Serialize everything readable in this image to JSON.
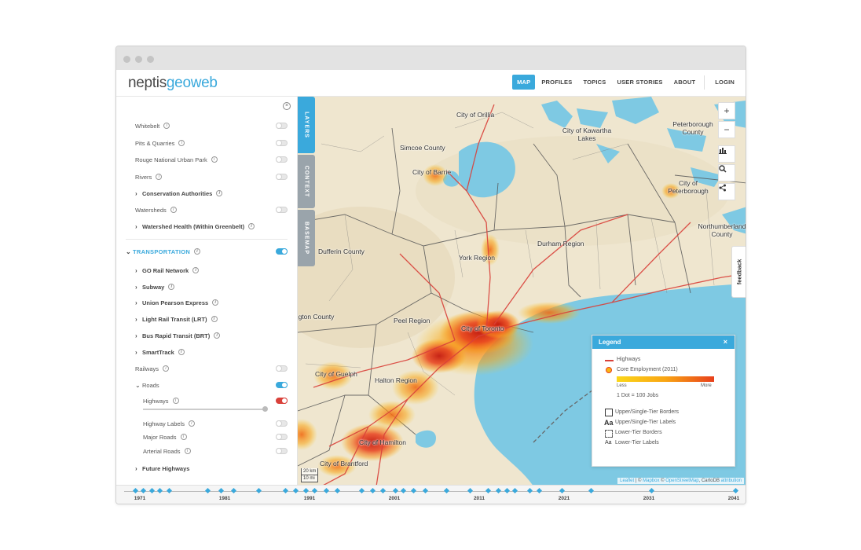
{
  "brand": {
    "part1": "neptis",
    "part2": "geoweb"
  },
  "nav": {
    "items": [
      "MAP",
      "PROFILES",
      "TOPICS",
      "USER STORIES",
      "ABOUT"
    ],
    "login": "LOGIN"
  },
  "side_tabs": [
    "LAYERS",
    "CONTEXT",
    "BASEMAP"
  ],
  "layers": {
    "items": [
      {
        "label": "Whitebelt",
        "type": "toggle",
        "state": "off"
      },
      {
        "label": "Pits & Quarries",
        "type": "toggle",
        "state": "off"
      },
      {
        "label": "Rouge National Urban Park",
        "type": "toggle",
        "state": "off"
      },
      {
        "label": "Rivers",
        "type": "toggle",
        "state": "off"
      },
      {
        "label": "Conservation Authorities",
        "type": "group"
      },
      {
        "label": "Watersheds",
        "type": "toggle",
        "state": "off"
      },
      {
        "label": "Watershed Health (Within Greenbelt)",
        "type": "group"
      }
    ],
    "transportation": {
      "title": "TRANSPORTATION",
      "state": "on",
      "items": [
        {
          "label": "GO Rail Network",
          "type": "group"
        },
        {
          "label": "Subway",
          "type": "group"
        },
        {
          "label": "Union Pearson Express",
          "type": "group"
        },
        {
          "label": "Light Rail Transit (LRT)",
          "type": "group"
        },
        {
          "label": "Bus Rapid Transit (BRT)",
          "type": "group"
        },
        {
          "label": "SmartTrack",
          "type": "group"
        },
        {
          "label": "Railways",
          "type": "toggle",
          "state": "off"
        }
      ],
      "roads": {
        "label": "Roads",
        "state": "on",
        "highways": {
          "label": "Highways",
          "state": "on",
          "color": "#d9413a"
        },
        "items": [
          {
            "label": "Highway Labels",
            "state": "off"
          },
          {
            "label": "Major Roads",
            "state": "off"
          },
          {
            "label": "Arterial Roads",
            "state": "off"
          }
        ]
      },
      "future": "Future Highways"
    }
  },
  "map": {
    "places": [
      "City of Orillia",
      "City of Kawartha Lakes",
      "Peterborough County",
      "Simcoe County",
      "City of Barrie",
      "City of Peterborough",
      "Northumberland County",
      "Dufferin County",
      "York Region",
      "Durham Region",
      "Wellington County",
      "Peel Region",
      "City of Toronto",
      "City of Guelph",
      "Halton Region",
      "City of Hamilton",
      "City of Brantford"
    ],
    "feedback": "feedback",
    "scale": {
      "km": "20 km",
      "mi": "10 mi"
    },
    "attribution": {
      "leaflet": "Leaflet",
      "mapbox": "Mapbox",
      "osm": "OpenStreetMap",
      "carto": "CartoDB",
      "attr": "attribution"
    }
  },
  "legend": {
    "title": "Legend",
    "highways": "Highways",
    "core_employment": "Core Employment (2011)",
    "less": "Less",
    "more": "More",
    "dot_note": "1 Dot = 100 Jobs",
    "upper_borders": "Upper/Single-Tier Borders",
    "upper_labels": "Upper/Single-Tier Labels",
    "lower_borders": "Lower-Tier Borders",
    "lower_labels": "Lower-Tier Labels",
    "label_sample": "Aa",
    "colors": {
      "water": "#7ec9e3",
      "land": "#efe6cf",
      "hot": "#e8401c",
      "warm": "#f9b514",
      "highway": "#d9413a"
    }
  },
  "timeline": {
    "years": [
      "1971",
      "1981",
      "1991",
      "2001",
      "2011",
      "2021",
      "2031",
      "2041"
    ]
  },
  "accent": "#3aa9dc"
}
